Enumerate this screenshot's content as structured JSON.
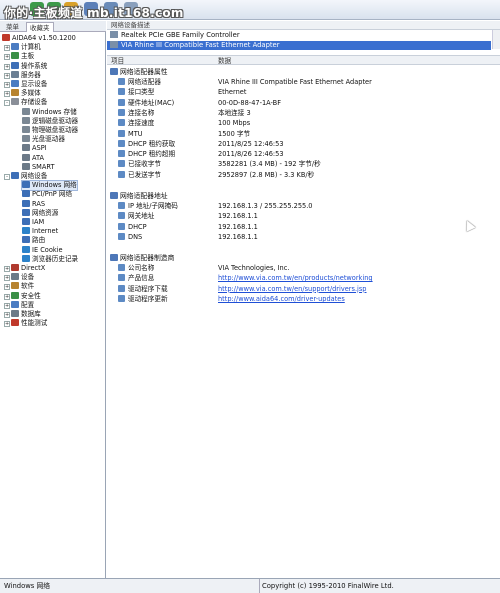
{
  "watermark": "你的·主板频道 mb.it168.com",
  "sidebar": {
    "tabs": [
      "菜单",
      "收藏夹"
    ],
    "items": [
      {
        "label": "AIDA64 v1.50.1200",
        "color": "#c0392b"
      },
      {
        "label": "计算机",
        "color": "#4a7cc2"
      },
      {
        "label": "主板",
        "color": "#3a8f46"
      },
      {
        "label": "操作系统",
        "color": "#3d6fb7"
      },
      {
        "label": "服务器",
        "color": "#6b7f93"
      },
      {
        "label": "显示设备",
        "color": "#4a7cc2"
      },
      {
        "label": "多媒体",
        "color": "#b7832f"
      },
      {
        "label": "存储设备",
        "color": "#8a8f98"
      },
      {
        "label": "Windows 存储",
        "color": "#7b8894"
      },
      {
        "label": "逻辑磁盘驱动器",
        "color": "#7b8894"
      },
      {
        "label": "物理磁盘驱动器",
        "color": "#7b8894"
      },
      {
        "label": "光盘驱动器",
        "color": "#7b8894"
      },
      {
        "label": "ASPI",
        "color": "#6c7a88"
      },
      {
        "label": "ATA",
        "color": "#6c7a88"
      },
      {
        "label": "SMART",
        "color": "#6c7a88"
      },
      {
        "label": "网络设备",
        "color": "#3d6fb7"
      },
      {
        "label": "Windows 网络",
        "color": "#3d6fb7"
      },
      {
        "label": "PCI/PnP 网络",
        "color": "#3d6fb7"
      },
      {
        "label": "RAS",
        "color": "#3d6fb7"
      },
      {
        "label": "网络资源",
        "color": "#3d6fb7"
      },
      {
        "label": "IAM",
        "color": "#3d6fb7"
      },
      {
        "label": "Internet",
        "color": "#2c82c9"
      },
      {
        "label": "路由",
        "color": "#3d6fb7"
      },
      {
        "label": "IE Cookie",
        "color": "#2c82c9"
      },
      {
        "label": "浏览器历史记录",
        "color": "#2c82c9"
      },
      {
        "label": "DirectX",
        "color": "#b03a2e"
      },
      {
        "label": "设备",
        "color": "#6c7a88"
      },
      {
        "label": "软件",
        "color": "#b7832f"
      },
      {
        "label": "安全性",
        "color": "#3a8f46"
      },
      {
        "label": "配置",
        "color": "#4a7cc2"
      },
      {
        "label": "数据库",
        "color": "#6c7a88"
      },
      {
        "label": "性能测试",
        "color": "#c0392b"
      }
    ]
  },
  "devices": {
    "header": "网络设备描述",
    "items": [
      "Realtek PCIe GBE Family Controller",
      "VIA Rhine III Compatible Fast Ethernet Adapter"
    ]
  },
  "columns": {
    "item": "项目",
    "data": "数据"
  },
  "groups": [
    {
      "title": "网络适配器属性",
      "rows": [
        {
          "label": "网络适配器",
          "value": "VIA Rhine III Compatible Fast Ethernet Adapter"
        },
        {
          "label": "接口类型",
          "value": "Ethernet"
        },
        {
          "label": "硬件地址(MAC)",
          "value": "00-0D-88-47-1A-BF"
        },
        {
          "label": "连接名称",
          "value": "本地连接 3"
        },
        {
          "label": "连接速度",
          "value": "100 Mbps"
        },
        {
          "label": "MTU",
          "value": "1500 字节"
        },
        {
          "label": "DHCP 租约获取",
          "value": "2011/8/25 12:46:53"
        },
        {
          "label": "DHCP 租约超期",
          "value": "2011/8/26 12:46:53"
        },
        {
          "label": "已接收字节",
          "value": "3582281 (3.4 MB) - 192 字节/秒"
        },
        {
          "label": "已发送字节",
          "value": "2952897 (2.8 MB) - 3.3 KB/秒"
        }
      ]
    },
    {
      "title": "网络适配器地址",
      "rows": [
        {
          "label": "IP 地址/子网掩码",
          "value": "192.168.1.3 / 255.255.255.0"
        },
        {
          "label": "网关地址",
          "value": "192.168.1.1"
        },
        {
          "label": "DHCP",
          "value": "192.168.1.1"
        },
        {
          "label": "DNS",
          "value": "192.168.1.1"
        }
      ]
    },
    {
      "title": "网络适配器制造商",
      "rows": [
        {
          "label": "公司名称",
          "value": "VIA Technologies, Inc."
        },
        {
          "label": "产品信息",
          "value": "http://www.via.com.tw/en/products/networking"
        },
        {
          "label": "驱动程序下载",
          "value": "http://www.via.com.tw/en/support/drivers.jsp"
        },
        {
          "label": "驱动程序更新",
          "value": "http://www.aida64.com/driver-updates"
        }
      ]
    }
  ],
  "statusbar": {
    "left": "Windows 网络",
    "right": "Copyright (c) 1995-2010 FinalWire Ltd."
  },
  "colors": {
    "selection": "#3a6fd0",
    "link": "#1f4fd6"
  }
}
